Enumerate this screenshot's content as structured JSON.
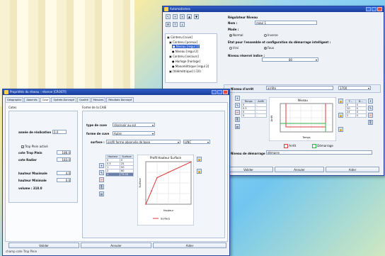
{
  "colors": {
    "accent": "#1a3d99",
    "red": "#e03a3a",
    "green": "#2db34a",
    "selection": "#2f5fd0"
  },
  "win1": {
    "title": "Automatismes",
    "toolbar_icons": [
      "pointer-icon",
      "add-icon",
      "delete-icon",
      "up-icon",
      "down-icon",
      "settings-icon",
      "up-arrow-icon",
      "down-arrow-icon"
    ],
    "tree": [
      "Contenu [cuve]",
      "Contenu [poreux]",
      "Niveau [regul 1]",
      "Niveau [regul 2]",
      "Contenu [secours]",
      "Horloge [horloge]",
      "Manométrique [regul 2]",
      "[télémétrique] (-10)"
    ],
    "heading": "Régulateur Niveau",
    "nom_label": "Nom :",
    "nom_value": "regul 1",
    "mode_label": "Mode :",
    "mode_normal": "Normal",
    "mode_inverse": "Inverse",
    "etat_label": "Etat pour l'ensemble et configuration du démarrage intelligent :",
    "etat_vrai": "Vrai",
    "etat_faux": "Faux",
    "reserve_label": "Niveau réservé indice :",
    "reserve_value": "80",
    "arret_label": "Niveau d'arrêt",
    "arret_value": "arrête",
    "arret_right": "1700",
    "table_headers": [
      "Temps",
      "Arrêt"
    ],
    "table_rows": [
      [
        "0",
        "-"
      ],
      [
        "0.5",
        "-"
      ],
      [
        "0",
        "-"
      ],
      [
        "0",
        "-"
      ]
    ],
    "chart_title": "Niveau",
    "chart_ylabel": "Arrêt",
    "chart_xlabel": "Temps",
    "right_table_headers": [
      "T...",
      "D..."
    ],
    "right_table_rows": [
      [
        "0",
        "0"
      ],
      [
        "20",
        "0"
      ],
      [
        "24",
        "0"
      ],
      [
        "2",
        "0"
      ]
    ],
    "legend_arret": "Arrêt",
    "legend_demarrage": "Démarrage",
    "demarrage_label": "Niveau de démarrage",
    "demarrage_value": "démarre",
    "btn_valider": "Valider",
    "btn_annuler": "Annuler",
    "btn_aider": "Aider"
  },
  "win2": {
    "title": "Propriétés du réseau : réserve [CROSTI]",
    "tabs": [
      "Géographie",
      "Abonnés",
      "Cuve",
      "Opérée-Donnayé",
      "Qualité",
      "Mesures",
      "Résultats Donnayé"
    ],
    "cotes_label": "Cotes",
    "forme_label": "Forme de la CAIE",
    "annee_label": "année de réalisation",
    "annee_value": "0.0",
    "tropplein_check": "Trop Plein activé",
    "cote_tp_label": "cote Trop Plein",
    "cote_tp_value": "186.0",
    "cote_radier_label": "cote Radier",
    "cote_radier_value": "183.0",
    "hmax_label": "hauteur Maximale",
    "hmax_value": "4.0",
    "hmin_label": "hauteur Minimale",
    "hmin_value": "0.0",
    "volume_label": "volume : 318.0",
    "type_cuve_label": "type de cuve",
    "type_cuve_value": "réservoir au sol",
    "forme_cuve_label": "forme de cuve",
    "forme_cuve_value": "Autre",
    "surface_label": "surface :",
    "surface_value": "profil forme observée de base",
    "surface_unit": "LINC",
    "table_headers": [
      "Hauteur",
      "Surface"
    ],
    "table_rows": [
      [
        "0",
        "0"
      ],
      [
        "0.5",
        "25"
      ],
      [
        "1",
        "50"
      ],
      [
        "2",
        "60"
      ],
      [
        "4",
        "79.58"
      ]
    ],
    "chart_title": "Profil Hauteur Surface",
    "chart_xlabel": "Hauteur",
    "chart_ylabel": "Surface",
    "legend": "Surface",
    "btn_valider": "Valider",
    "btn_annuler": "Annuler",
    "btn_aider": "Aider",
    "status": "champ cote Trop Plein"
  }
}
